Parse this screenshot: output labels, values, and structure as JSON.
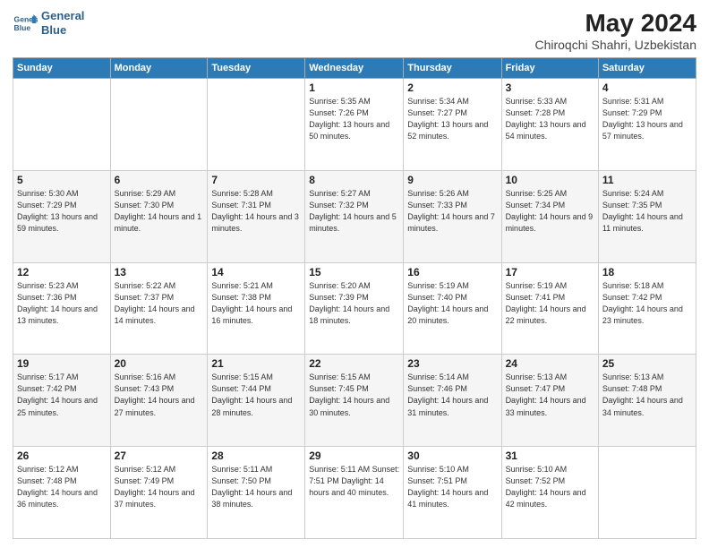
{
  "logo": {
    "line1": "General",
    "line2": "Blue"
  },
  "title": "May 2024",
  "subtitle": "Chiroqchi Shahri, Uzbekistan",
  "header_days": [
    "Sunday",
    "Monday",
    "Tuesday",
    "Wednesday",
    "Thursday",
    "Friday",
    "Saturday"
  ],
  "weeks": [
    [
      {
        "day": "",
        "info": ""
      },
      {
        "day": "",
        "info": ""
      },
      {
        "day": "",
        "info": ""
      },
      {
        "day": "1",
        "info": "Sunrise: 5:35 AM\nSunset: 7:26 PM\nDaylight: 13 hours\nand 50 minutes."
      },
      {
        "day": "2",
        "info": "Sunrise: 5:34 AM\nSunset: 7:27 PM\nDaylight: 13 hours\nand 52 minutes."
      },
      {
        "day": "3",
        "info": "Sunrise: 5:33 AM\nSunset: 7:28 PM\nDaylight: 13 hours\nand 54 minutes."
      },
      {
        "day": "4",
        "info": "Sunrise: 5:31 AM\nSunset: 7:29 PM\nDaylight: 13 hours\nand 57 minutes."
      }
    ],
    [
      {
        "day": "5",
        "info": "Sunrise: 5:30 AM\nSunset: 7:29 PM\nDaylight: 13 hours\nand 59 minutes."
      },
      {
        "day": "6",
        "info": "Sunrise: 5:29 AM\nSunset: 7:30 PM\nDaylight: 14 hours\nand 1 minute."
      },
      {
        "day": "7",
        "info": "Sunrise: 5:28 AM\nSunset: 7:31 PM\nDaylight: 14 hours\nand 3 minutes."
      },
      {
        "day": "8",
        "info": "Sunrise: 5:27 AM\nSunset: 7:32 PM\nDaylight: 14 hours\nand 5 minutes."
      },
      {
        "day": "9",
        "info": "Sunrise: 5:26 AM\nSunset: 7:33 PM\nDaylight: 14 hours\nand 7 minutes."
      },
      {
        "day": "10",
        "info": "Sunrise: 5:25 AM\nSunset: 7:34 PM\nDaylight: 14 hours\nand 9 minutes."
      },
      {
        "day": "11",
        "info": "Sunrise: 5:24 AM\nSunset: 7:35 PM\nDaylight: 14 hours\nand 11 minutes."
      }
    ],
    [
      {
        "day": "12",
        "info": "Sunrise: 5:23 AM\nSunset: 7:36 PM\nDaylight: 14 hours\nand 13 minutes."
      },
      {
        "day": "13",
        "info": "Sunrise: 5:22 AM\nSunset: 7:37 PM\nDaylight: 14 hours\nand 14 minutes."
      },
      {
        "day": "14",
        "info": "Sunrise: 5:21 AM\nSunset: 7:38 PM\nDaylight: 14 hours\nand 16 minutes."
      },
      {
        "day": "15",
        "info": "Sunrise: 5:20 AM\nSunset: 7:39 PM\nDaylight: 14 hours\nand 18 minutes."
      },
      {
        "day": "16",
        "info": "Sunrise: 5:19 AM\nSunset: 7:40 PM\nDaylight: 14 hours\nand 20 minutes."
      },
      {
        "day": "17",
        "info": "Sunrise: 5:19 AM\nSunset: 7:41 PM\nDaylight: 14 hours\nand 22 minutes."
      },
      {
        "day": "18",
        "info": "Sunrise: 5:18 AM\nSunset: 7:42 PM\nDaylight: 14 hours\nand 23 minutes."
      }
    ],
    [
      {
        "day": "19",
        "info": "Sunrise: 5:17 AM\nSunset: 7:42 PM\nDaylight: 14 hours\nand 25 minutes."
      },
      {
        "day": "20",
        "info": "Sunrise: 5:16 AM\nSunset: 7:43 PM\nDaylight: 14 hours\nand 27 minutes."
      },
      {
        "day": "21",
        "info": "Sunrise: 5:15 AM\nSunset: 7:44 PM\nDaylight: 14 hours\nand 28 minutes."
      },
      {
        "day": "22",
        "info": "Sunrise: 5:15 AM\nSunset: 7:45 PM\nDaylight: 14 hours\nand 30 minutes."
      },
      {
        "day": "23",
        "info": "Sunrise: 5:14 AM\nSunset: 7:46 PM\nDaylight: 14 hours\nand 31 minutes."
      },
      {
        "day": "24",
        "info": "Sunrise: 5:13 AM\nSunset: 7:47 PM\nDaylight: 14 hours\nand 33 minutes."
      },
      {
        "day": "25",
        "info": "Sunrise: 5:13 AM\nSunset: 7:48 PM\nDaylight: 14 hours\nand 34 minutes."
      }
    ],
    [
      {
        "day": "26",
        "info": "Sunrise: 5:12 AM\nSunset: 7:48 PM\nDaylight: 14 hours\nand 36 minutes."
      },
      {
        "day": "27",
        "info": "Sunrise: 5:12 AM\nSunset: 7:49 PM\nDaylight: 14 hours\nand 37 minutes."
      },
      {
        "day": "28",
        "info": "Sunrise: 5:11 AM\nSunset: 7:50 PM\nDaylight: 14 hours\nand 38 minutes."
      },
      {
        "day": "29",
        "info": "Sunrise: 5:11 AM\nSunset: 7:51 PM\nDaylight: 14 hours\nand 40 minutes."
      },
      {
        "day": "30",
        "info": "Sunrise: 5:10 AM\nSunset: 7:51 PM\nDaylight: 14 hours\nand 41 minutes."
      },
      {
        "day": "31",
        "info": "Sunrise: 5:10 AM\nSunset: 7:52 PM\nDaylight: 14 hours\nand 42 minutes."
      },
      {
        "day": "",
        "info": ""
      }
    ]
  ]
}
